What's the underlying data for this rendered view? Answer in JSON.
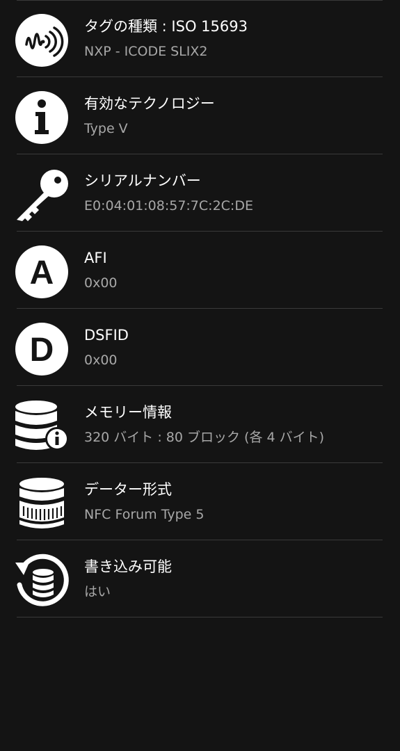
{
  "rows": [
    {
      "title": "タグの種類 : ISO 15693",
      "value": "NXP - ICODE SLIX2",
      "icon": "nfc-tag-icon"
    },
    {
      "title": "有効なテクノロジー",
      "value": "Type V",
      "icon": "info-icon"
    },
    {
      "title": "シリアルナンバー",
      "value": "E0:04:01:08:57:7C:2C:DE",
      "icon": "key-icon"
    },
    {
      "title": "AFI",
      "value": "0x00",
      "icon": "letter-a-icon",
      "icon_letter": "A"
    },
    {
      "title": "DSFID",
      "value": "0x00",
      "icon": "letter-d-icon",
      "icon_letter": "D"
    },
    {
      "title": "メモリー情報",
      "value": "320 バイト : 80 ブロック (各 4 バイト)",
      "icon": "database-info-icon"
    },
    {
      "title": "データー形式",
      "value": "NFC Forum Type 5",
      "icon": "coin-stack-icon"
    },
    {
      "title": "書き込み可能",
      "value": "はい",
      "icon": "writable-database-icon"
    }
  ],
  "colors": {
    "background": "#141414",
    "divider": "#3a3a3a",
    "title": "#ffffff",
    "value": "#a8a8a8",
    "icon": "#ffffff"
  }
}
